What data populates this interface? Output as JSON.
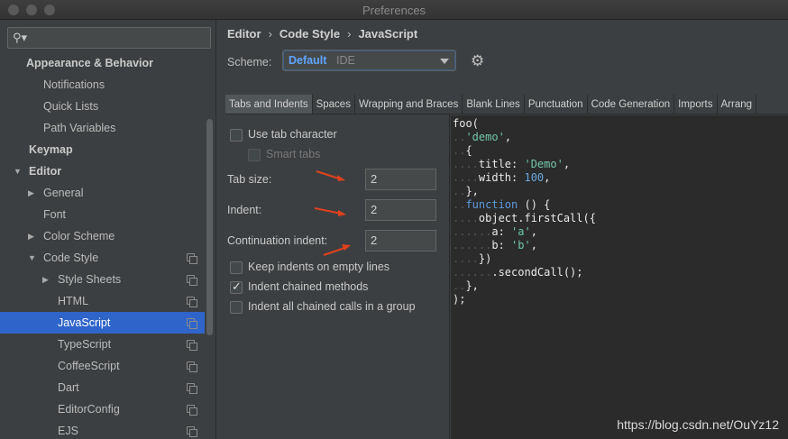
{
  "window": {
    "title": "Preferences"
  },
  "sidebar": {
    "search_value": "",
    "items": [
      {
        "label": "Appearance & Behavior",
        "bold": true,
        "indent": 0,
        "arrow": "",
        "copy": false,
        "selected": false
      },
      {
        "label": "Notifications",
        "bold": false,
        "indent": 1,
        "arrow": "",
        "copy": false,
        "selected": false
      },
      {
        "label": "Quick Lists",
        "bold": false,
        "indent": 1,
        "arrow": "",
        "copy": false,
        "selected": false
      },
      {
        "label": "Path Variables",
        "bold": false,
        "indent": 1,
        "arrow": "",
        "copy": false,
        "selected": false
      },
      {
        "label": "Keymap",
        "bold": true,
        "indent": 0,
        "arrow": "",
        "copy": false,
        "selected": false
      },
      {
        "label": "Editor",
        "bold": true,
        "indent": 0,
        "arrow": "down",
        "copy": false,
        "selected": false
      },
      {
        "label": "General",
        "bold": false,
        "indent": 1,
        "arrow": "right",
        "copy": false,
        "selected": false
      },
      {
        "label": "Font",
        "bold": false,
        "indent": 1,
        "arrow": "",
        "copy": false,
        "selected": false
      },
      {
        "label": "Color Scheme",
        "bold": false,
        "indent": 1,
        "arrow": "right",
        "copy": false,
        "selected": false
      },
      {
        "label": "Code Style",
        "bold": false,
        "indent": 1,
        "arrow": "down",
        "copy": true,
        "selected": false
      },
      {
        "label": "Style Sheets",
        "bold": false,
        "indent": 2,
        "arrow": "right",
        "copy": true,
        "selected": false
      },
      {
        "label": "HTML",
        "bold": false,
        "indent": 2,
        "arrow": "",
        "copy": true,
        "selected": false
      },
      {
        "label": "JavaScript",
        "bold": false,
        "indent": 2,
        "arrow": "",
        "copy": true,
        "selected": true
      },
      {
        "label": "TypeScript",
        "bold": false,
        "indent": 2,
        "arrow": "",
        "copy": true,
        "selected": false
      },
      {
        "label": "CoffeeScript",
        "bold": false,
        "indent": 2,
        "arrow": "",
        "copy": true,
        "selected": false
      },
      {
        "label": "Dart",
        "bold": false,
        "indent": 2,
        "arrow": "",
        "copy": true,
        "selected": false
      },
      {
        "label": "EditorConfig",
        "bold": false,
        "indent": 2,
        "arrow": "",
        "copy": true,
        "selected": false
      },
      {
        "label": "EJS",
        "bold": false,
        "indent": 2,
        "arrow": "",
        "copy": true,
        "selected": false
      }
    ]
  },
  "breadcrumb": {
    "items": [
      "Editor",
      "Code Style",
      "JavaScript"
    ],
    "separator": "›"
  },
  "scheme": {
    "label": "Scheme:",
    "value": "Default",
    "sub": "IDE"
  },
  "tabs": [
    "Tabs and Indents",
    "Spaces",
    "Wrapping and Braces",
    "Blank Lines",
    "Punctuation",
    "Code Generation",
    "Imports",
    "Arrang"
  ],
  "active_tab": 0,
  "options": {
    "use_tab_character": {
      "label": "Use tab character",
      "checked": false
    },
    "smart_tabs": {
      "label": "Smart tabs",
      "checked": false,
      "disabled": true
    },
    "tab_size": {
      "label": "Tab size:",
      "value": "2"
    },
    "indent": {
      "label": "Indent:",
      "value": "2"
    },
    "continuation_indent": {
      "label": "Continuation indent:",
      "value": "2"
    },
    "keep_indents": {
      "label": "Keep indents on empty lines",
      "checked": false
    },
    "indent_chained": {
      "label": "Indent chained methods",
      "checked": true
    },
    "indent_all_chained": {
      "label": "Indent all chained calls in a group",
      "checked": false
    }
  },
  "code_lines": [
    [
      [
        "",
        "foo("
      ]
    ],
    [
      [
        "ind",
        ".."
      ],
      [
        "str",
        "'demo'"
      ],
      [
        "",
        ","
      ]
    ],
    [
      [
        "ind",
        ".."
      ],
      [
        "",
        "{"
      ]
    ],
    [
      [
        "ind",
        "...."
      ],
      [
        "",
        "title: "
      ],
      [
        "str",
        "'Demo'"
      ],
      [
        "",
        ","
      ]
    ],
    [
      [
        "ind",
        "...."
      ],
      [
        "",
        "width: "
      ],
      [
        "num",
        "100"
      ],
      [
        "",
        ","
      ]
    ],
    [
      [
        "ind",
        ".."
      ],
      [
        "",
        "},"
      ]
    ],
    [
      [
        "ind",
        ".."
      ],
      [
        "kw",
        "function"
      ],
      [
        "",
        " () {"
      ]
    ],
    [
      [
        "ind",
        "...."
      ],
      [
        "",
        "object.firstCall({"
      ]
    ],
    [
      [
        "ind",
        "......"
      ],
      [
        "",
        "a: "
      ],
      [
        "str",
        "'a'"
      ],
      [
        "",
        ","
      ]
    ],
    [
      [
        "ind",
        "......"
      ],
      [
        "",
        "b: "
      ],
      [
        "str",
        "'b'"
      ],
      [
        "",
        ","
      ]
    ],
    [
      [
        "ind",
        "...."
      ],
      [
        "",
        "})"
      ]
    ],
    [
      [
        "ind",
        "......"
      ],
      [
        "",
        ".secondCall();"
      ]
    ],
    [
      [
        "ind",
        ".."
      ],
      [
        "",
        "},"
      ]
    ],
    [
      [
        "",
        ");"
      ]
    ]
  ],
  "watermark": "https://blog.csdn.net/OuYz12",
  "colors": {
    "selection": "#2f65ca",
    "accent": "#5ea4ff",
    "annotation_arrow": "#e0401e"
  }
}
